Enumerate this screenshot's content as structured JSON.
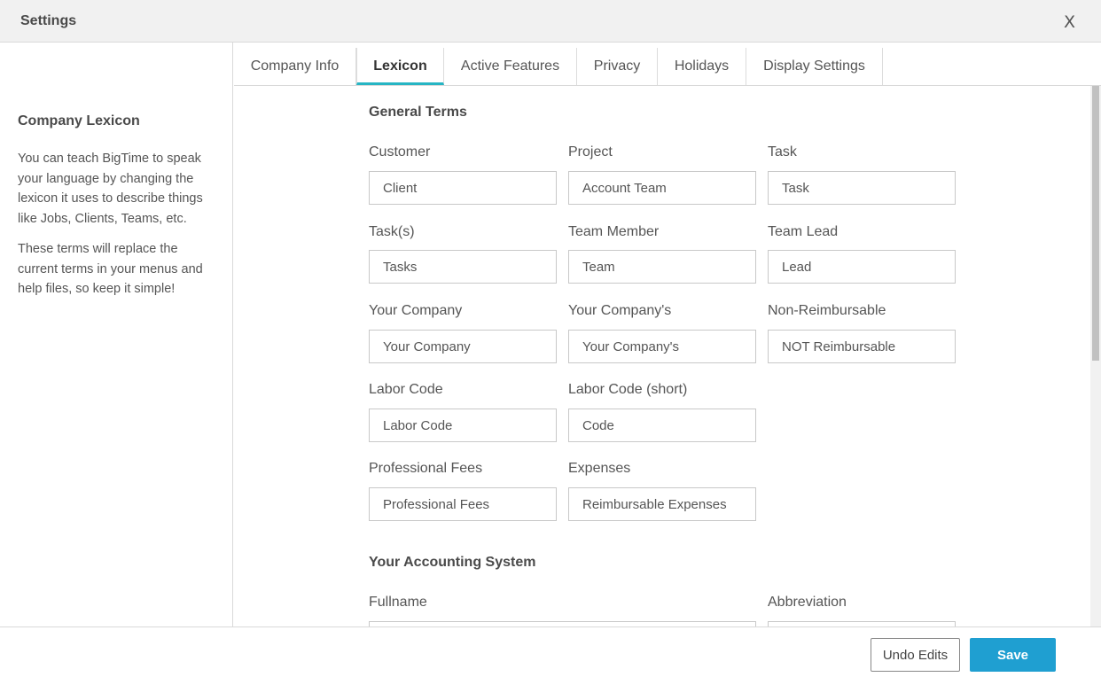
{
  "window": {
    "title": "Settings",
    "close_label": "X"
  },
  "sidebar": {
    "heading": "Company Lexicon",
    "paragraph1": "You can teach BigTime to speak your language by changing the lexicon it uses to describe things like Jobs, Clients, Teams, etc.",
    "paragraph2": "These terms will replace the current terms in your menus and help files, so keep it simple!"
  },
  "tabs": [
    {
      "label": "Company Info",
      "active": false
    },
    {
      "label": "Lexicon",
      "active": true
    },
    {
      "label": "Active Features",
      "active": false
    },
    {
      "label": "Privacy",
      "active": false
    },
    {
      "label": "Holidays",
      "active": false
    },
    {
      "label": "Display Settings",
      "active": false
    }
  ],
  "general_terms": {
    "title": "General Terms",
    "fields": [
      {
        "label": "Customer",
        "value": "Client"
      },
      {
        "label": "Project",
        "value": "Account Team"
      },
      {
        "label": "Task",
        "value": "Task"
      },
      {
        "label": "Task(s)",
        "value": "Tasks"
      },
      {
        "label": "Team Member",
        "value": "Team"
      },
      {
        "label": "Team Lead",
        "value": "Lead"
      },
      {
        "label": "Your Company",
        "value": "Your Company"
      },
      {
        "label": "Your Company's",
        "value": "Your Company's"
      },
      {
        "label": "Non-Reimbursable",
        "value": "NOT Reimbursable"
      },
      {
        "label": "Labor Code",
        "value": "Labor Code"
      },
      {
        "label": "Labor Code (short)",
        "value": "Code"
      },
      {
        "label": "Professional Fees",
        "value": "Professional Fees"
      },
      {
        "label": "Expenses",
        "value": "Reimbursable Expenses"
      }
    ]
  },
  "accounting": {
    "title": "Your Accounting System",
    "fullname_label": "Fullname",
    "fullname_value": "",
    "abbreviation_label": "Abbreviation",
    "abbreviation_value": ""
  },
  "footer": {
    "undo_label": "Undo Edits",
    "save_label": "Save"
  },
  "colors": {
    "accent": "#26b5c4",
    "save_button": "#1f9fd1"
  }
}
